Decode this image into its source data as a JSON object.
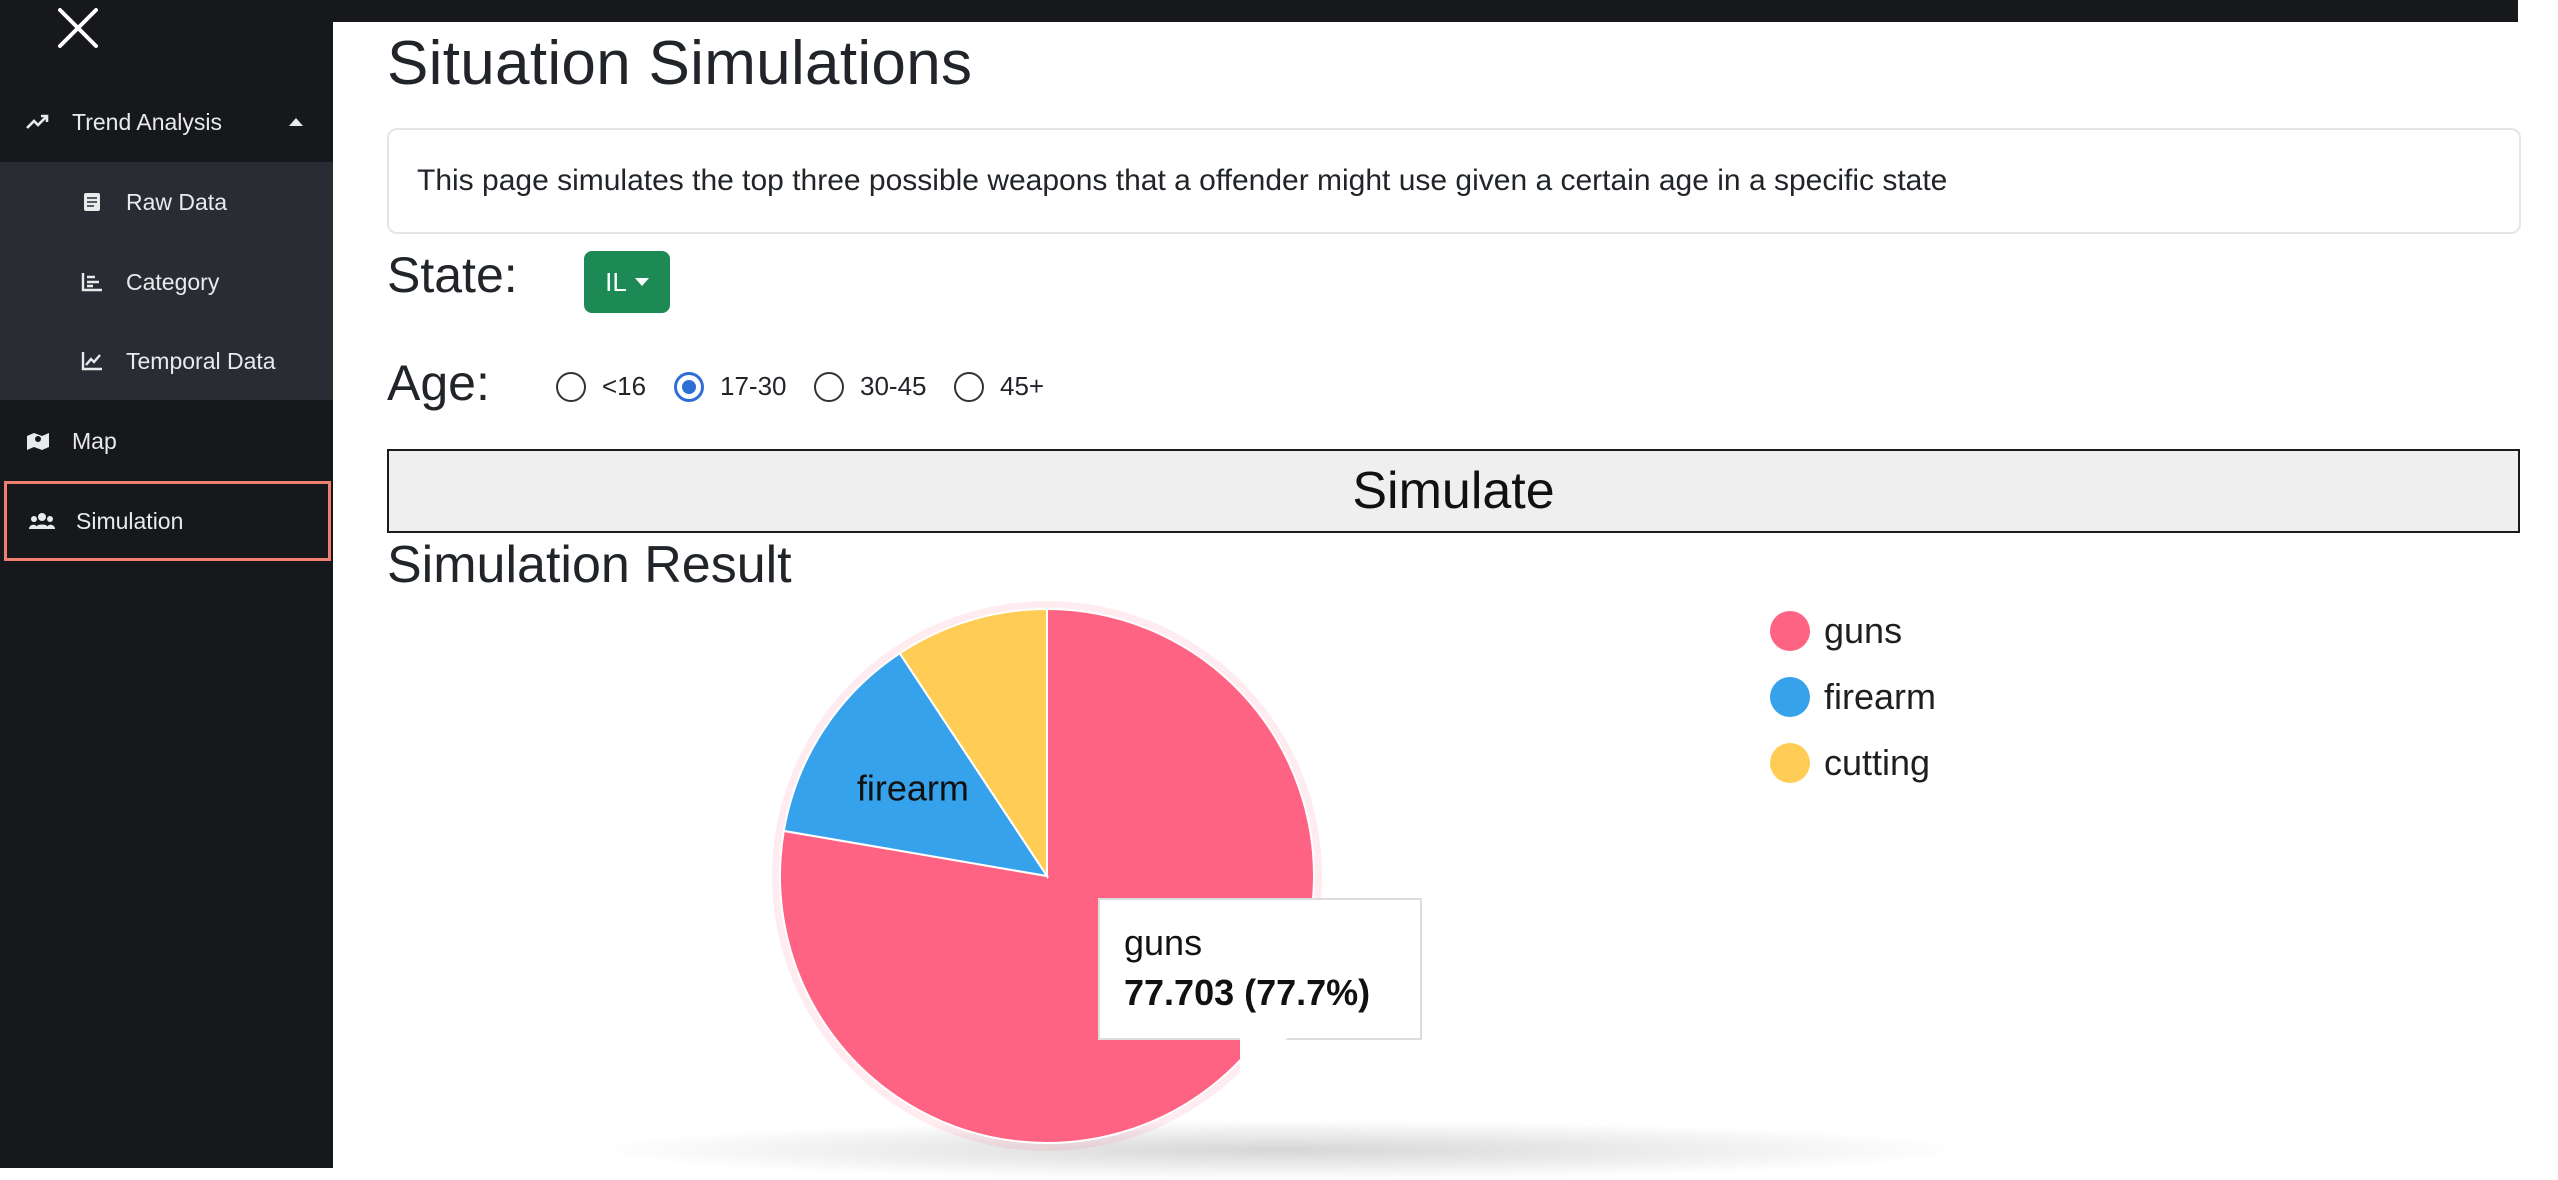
{
  "sidebar": {
    "items": [
      {
        "label": "Trend Analysis",
        "icon": "trending-up-icon"
      },
      {
        "label": "Raw Data",
        "icon": "document-icon"
      },
      {
        "label": "Category",
        "icon": "bar-chart-icon"
      },
      {
        "label": "Temporal Data",
        "icon": "line-chart-icon"
      },
      {
        "label": "Map",
        "icon": "map-icon"
      },
      {
        "label": "Simulation",
        "icon": "users-icon"
      }
    ]
  },
  "page": {
    "title": "Situation Simulations",
    "description": "This page simulates the top three possible weapons that a offender might use given a certain age in a specific state"
  },
  "form": {
    "state_label": "State:",
    "state_value": "IL",
    "age_label": "Age:",
    "age_options": [
      "<16",
      "17-30",
      "30-45",
      "45+"
    ],
    "age_selected": "17-30",
    "simulate_label": "Simulate"
  },
  "result": {
    "heading": "Simulation Result",
    "tooltip": {
      "label": "guns",
      "value": "77.703 (77.7%)"
    },
    "slice_label": "firearm"
  },
  "chart_data": {
    "type": "pie",
    "categories": [
      "guns",
      "firearm",
      "cutting"
    ],
    "values": [
      77.703,
      13.0,
      9.297
    ],
    "colors": [
      "#ff6384",
      "#36a2eb",
      "#ffcd56"
    ],
    "legend_position": "right"
  }
}
